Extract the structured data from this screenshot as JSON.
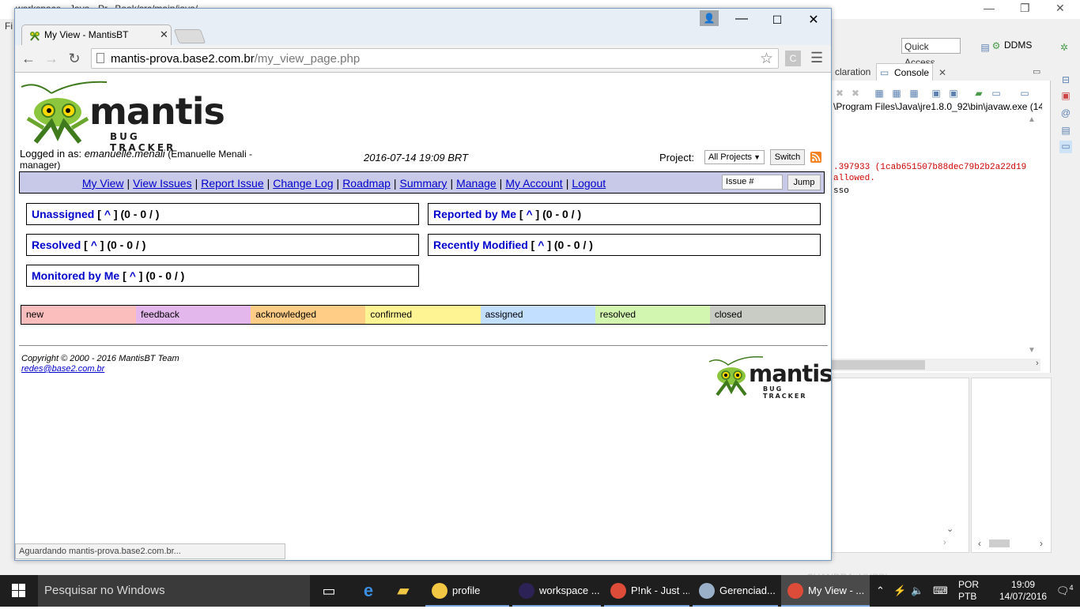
{
  "background_ide": {
    "title_fragment": "workspace - Java - Pr...Book/src/main/java/...",
    "menu_fragment": "Fi",
    "quick_access": "Quick Access",
    "perspective": "DDMS",
    "tab_declaration": "claration",
    "tab_console": "Console",
    "console_path": "\\Program Files\\Java\\jre1.8.0_92\\bin\\javaw.exe (14 de",
    "console_line1": ".397933 (1cab651507b88dec79b2b2a22d19",
    "console_line2": " allowed.",
    "console_line3": "sso",
    "watermark": "CHANDRA, HUBBL"
  },
  "browser": {
    "tab_title": "My View - MantisBT",
    "url_host": "mantis-prova.base2.com.br",
    "url_path": "/my_view_page.php",
    "ext_label": "C",
    "status": "Aguardando mantis-prova.base2.com.br..."
  },
  "mantis": {
    "logo_word": "mantis",
    "logo_sub": "BUG TRACKER",
    "logged_in_label": "Logged in as:",
    "username": "emanuelle.menali",
    "fullname_role": "(Emanuelle Menali -",
    "role_line": "manager)",
    "datetime": "2016-07-14 19:09 BRT",
    "project_label": "Project:",
    "project_value": "All Projects",
    "switch_label": "Switch",
    "issue_placeholder": "Issue #",
    "jump_label": "Jump",
    "menu": {
      "my_view": "My View",
      "view_issues": "View Issues",
      "report_issue": "Report Issue",
      "change_log": "Change Log",
      "roadmap": "Roadmap",
      "summary": "Summary",
      "manage": "Manage",
      "my_account": "My Account",
      "logout": "Logout",
      "sep": "|"
    },
    "boxes": {
      "unassigned": {
        "title": "Unassigned",
        "count": "(0 - 0 / )"
      },
      "reported": {
        "title": "Reported by Me",
        "count": "(0 - 0 / )"
      },
      "resolved": {
        "title": "Resolved",
        "count": "(0 - 0 / )"
      },
      "modified": {
        "title": "Recently Modified",
        "count": "(0 - 0 / )"
      },
      "monitored": {
        "title": "Monitored by Me",
        "count": "(0 - 0 / )"
      },
      "up_link": "^"
    },
    "statuses": [
      {
        "label": "new",
        "color": "#fcbdbd"
      },
      {
        "label": "feedback",
        "color": "#e3b7eb"
      },
      {
        "label": "acknowledged",
        "color": "#ffcd85"
      },
      {
        "label": "confirmed",
        "color": "#fff494"
      },
      {
        "label": "assigned",
        "color": "#c2dfff"
      },
      {
        "label": "resolved",
        "color": "#d2f5b0"
      },
      {
        "label": "closed",
        "color": "#c9ccc4"
      }
    ],
    "copyright": "Copyright © 2000 - 2016 MantisBT Team",
    "contact_email": "redes@base2.com.br"
  },
  "taskbar": {
    "search_placeholder": "Pesquisar no Windows",
    "apps": [
      {
        "label": "profile",
        "color": "#f2c744"
      },
      {
        "label": "workspace ...",
        "color": "#2c2255"
      },
      {
        "label": "P!nk - Just ...",
        "color": "#dd4b39"
      },
      {
        "label": "Gerenciad...",
        "color": "#9ab0c8"
      },
      {
        "label": "My View - ...",
        "color": "#dd4b39"
      }
    ],
    "lang1": "POR",
    "lang2": "PTB",
    "time": "19:09",
    "date": "14/07/2016",
    "notifications": "4"
  }
}
